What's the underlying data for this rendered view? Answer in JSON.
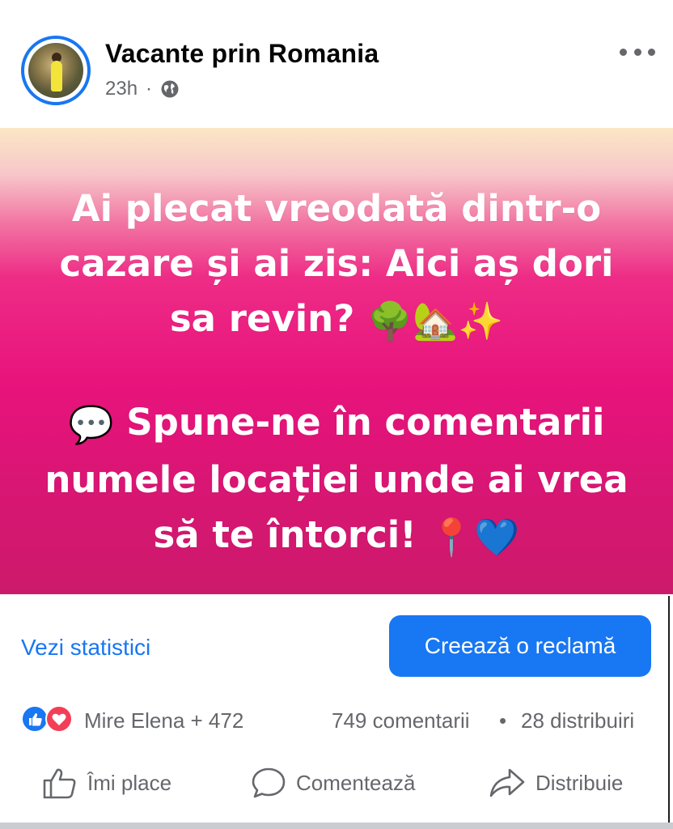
{
  "post": {
    "page_name": "Vacante prin Romania",
    "time": "23h",
    "separator": "·",
    "privacy_icon": "globe-icon",
    "menu_icon": "more-horizontal-icon"
  },
  "banner": {
    "line1": "Ai plecat vreodată dintr-o cazare și ai zis: Aici aș dori sa  revin?",
    "line1_emojis": "🌳🏡✨",
    "line2_emoji": "💬",
    "line2": "Spune-ne în comentarii numele locației unde ai vrea să te întorci!",
    "line2_emojis": "📍💙",
    "gradient": [
      "#fbe7c5",
      "#ee2c86",
      "#cc1a6b"
    ]
  },
  "insights": {
    "stats_link": "Vezi statistici",
    "ad_button": "Creează o reclamă"
  },
  "reactions": {
    "icons": [
      "like-icon",
      "love-icon"
    ],
    "names": "Mire Elena + 472",
    "comments": "749 comentarii",
    "dot": "•",
    "shares": "28 distribuiri"
  },
  "actions": {
    "like": "Îmi place",
    "comment": "Comentează",
    "share": "Distribuie"
  },
  "colors": {
    "accent": "#1877f2",
    "secondary_text": "#65676b",
    "love": "#f33e58"
  }
}
